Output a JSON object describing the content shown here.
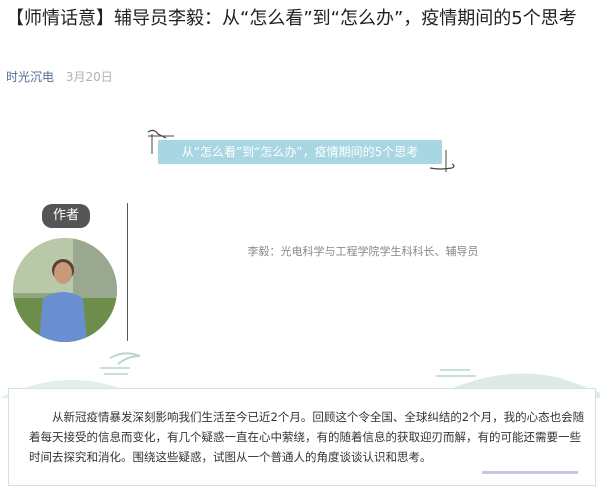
{
  "article": {
    "title": "【师情话意】辅导员李毅：从“怎么看”到“怎么办”，疫情期间的5个思考",
    "account": "时光沉电",
    "date": "3月20日"
  },
  "banner": {
    "text": "从“怎么看”到“怎么办”，疫情期间的5个思考"
  },
  "author": {
    "badge": "作者",
    "info": "李毅：光电科学与工程学院学生科科长、辅导员"
  },
  "intro": {
    "text": "从新冠疫情暴发深刻影响我们生活至今已近2个月。回顾这个令全国、全球纠结的2个月，我的心态也会随着每天接受的信息而变化，有几个疑惑一直在心中萦绕，有的随着信息的获取迎刃而解，有的可能还需要一些时间去探究和消化。围绕这些疑惑，试图从一个普通人的角度谈谈认识和思考。"
  },
  "colors": {
    "banner_bg": "#a8d6e3",
    "account_link": "#576b95",
    "badge_bg": "#555555"
  }
}
